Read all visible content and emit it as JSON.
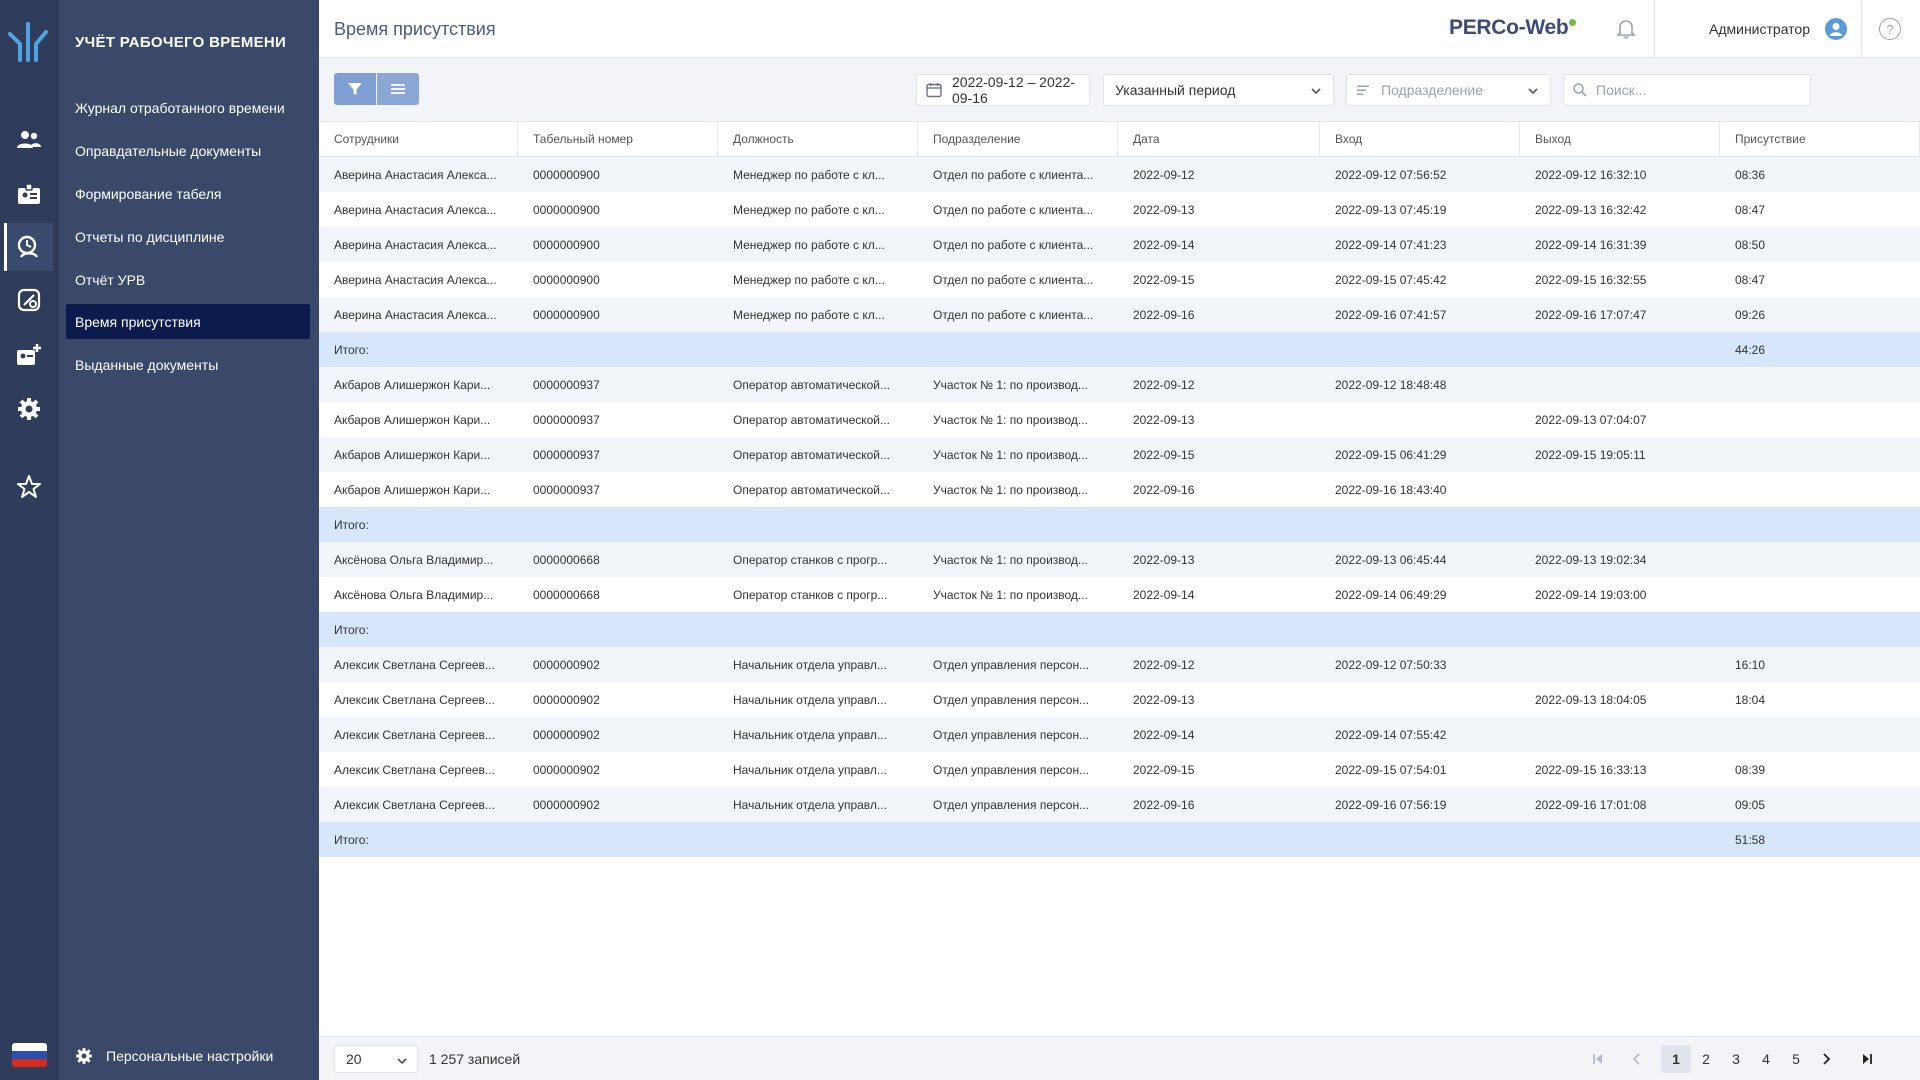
{
  "app": {
    "section_title": "УЧЁТ РАБОЧЕГО ВРЕМЕНИ",
    "page_title": "Время присутствия",
    "brand": "PERCo-Web",
    "user": "Администратор",
    "help_glyph": "?",
    "personal_settings": "Персональные настройки"
  },
  "rail_icons": [
    "logo-icon",
    "users-icon",
    "badge-icon",
    "time-attendance-icon",
    "access-icon",
    "add-employee-icon",
    "settings-icon",
    "favorites-icon",
    "flag-ru-icon"
  ],
  "menu": [
    {
      "label": "Журнал отработанного времени",
      "active": false
    },
    {
      "label": "Оправдательные документы",
      "active": false
    },
    {
      "label": "Формирование табеля",
      "active": false
    },
    {
      "label": "Отчеты по дисциплине",
      "active": false
    },
    {
      "label": "Отчёт УРВ",
      "active": false
    },
    {
      "label": "Время присутствия",
      "active": true
    },
    {
      "label": "Выданные документы",
      "active": false
    }
  ],
  "toolbar": {
    "date_range": "2022-09-12 – 2022-09-16",
    "period": "Указанный период",
    "department_placeholder": "Подразделение",
    "search_placeholder": "Поиск..."
  },
  "table": {
    "columns": [
      "Сотрудники",
      "Табельный номер",
      "Должность",
      "Подразделение",
      "Дата",
      "Вход",
      "Выход",
      "Присутствие"
    ],
    "rows": [
      {
        "type": "data",
        "cells": [
          "Аверина Анастасия Алекса...",
          "0000000900",
          "Менеджер по работе с кл...",
          "Отдел по работе с клиента...",
          "2022-09-12",
          "2022-09-12 07:56:52",
          "2022-09-12 16:32:10",
          "08:36"
        ]
      },
      {
        "type": "data",
        "cells": [
          "Аверина Анастасия Алекса...",
          "0000000900",
          "Менеджер по работе с кл...",
          "Отдел по работе с клиента...",
          "2022-09-13",
          "2022-09-13 07:45:19",
          "2022-09-13 16:32:42",
          "08:47"
        ]
      },
      {
        "type": "data",
        "cells": [
          "Аверина Анастасия Алекса...",
          "0000000900",
          "Менеджер по работе с кл...",
          "Отдел по работе с клиента...",
          "2022-09-14",
          "2022-09-14 07:41:23",
          "2022-09-14 16:31:39",
          "08:50"
        ]
      },
      {
        "type": "data",
        "cells": [
          "Аверина Анастасия Алекса...",
          "0000000900",
          "Менеджер по работе с кл...",
          "Отдел по работе с клиента...",
          "2022-09-15",
          "2022-09-15 07:45:42",
          "2022-09-15 16:32:55",
          "08:47"
        ]
      },
      {
        "type": "data",
        "cells": [
          "Аверина Анастасия Алекса...",
          "0000000900",
          "Менеджер по работе с кл...",
          "Отдел по работе с клиента...",
          "2022-09-16",
          "2022-09-16 07:41:57",
          "2022-09-16 17:07:47",
          "09:26"
        ]
      },
      {
        "type": "total",
        "cells": [
          "Итого:",
          "",
          "",
          "",
          "",
          "",
          "",
          "44:26"
        ]
      },
      {
        "type": "data",
        "cells": [
          "Акбаров Алишержон Кари...",
          "0000000937",
          "Оператор автоматической...",
          "Участок № 1: по производ...",
          "2022-09-12",
          "2022-09-12 18:48:48",
          "",
          ""
        ]
      },
      {
        "type": "data",
        "cells": [
          "Акбаров Алишержон Кари...",
          "0000000937",
          "Оператор автоматической...",
          "Участок № 1: по производ...",
          "2022-09-13",
          "",
          "2022-09-13 07:04:07",
          ""
        ]
      },
      {
        "type": "data",
        "cells": [
          "Акбаров Алишержон Кари...",
          "0000000937",
          "Оператор автоматической...",
          "Участок № 1: по производ...",
          "2022-09-15",
          "2022-09-15 06:41:29",
          "2022-09-15 19:05:11",
          ""
        ]
      },
      {
        "type": "data",
        "cells": [
          "Акбаров Алишержон Кари...",
          "0000000937",
          "Оператор автоматической...",
          "Участок № 1: по производ...",
          "2022-09-16",
          "2022-09-16 18:43:40",
          "",
          ""
        ]
      },
      {
        "type": "total",
        "cells": [
          "Итого:",
          "",
          "",
          "",
          "",
          "",
          "",
          ""
        ]
      },
      {
        "type": "data",
        "cells": [
          "Аксёнова Ольга Владимир...",
          "0000000668",
          "Оператор станков с прогр...",
          "Участок № 1: по производ...",
          "2022-09-13",
          "2022-09-13 06:45:44",
          "2022-09-13 19:02:34",
          ""
        ]
      },
      {
        "type": "data",
        "cells": [
          "Аксёнова Ольга Владимир...",
          "0000000668",
          "Оператор станков с прогр...",
          "Участок № 1: по производ...",
          "2022-09-14",
          "2022-09-14 06:49:29",
          "2022-09-14 19:03:00",
          ""
        ]
      },
      {
        "type": "total",
        "cells": [
          "Итого:",
          "",
          "",
          "",
          "",
          "",
          "",
          ""
        ]
      },
      {
        "type": "data",
        "cells": [
          "Алексик Светлана Сергеев...",
          "0000000902",
          "Начальник отдела управл...",
          "Отдел управления персон...",
          "2022-09-12",
          "2022-09-12 07:50:33",
          "",
          "16:10"
        ]
      },
      {
        "type": "data",
        "cells": [
          "Алексик Светлана Сергеев...",
          "0000000902",
          "Начальник отдела управл...",
          "Отдел управления персон...",
          "2022-09-13",
          "",
          "2022-09-13 18:04:05",
          "18:04"
        ]
      },
      {
        "type": "data",
        "cells": [
          "Алексик Светлана Сергеев...",
          "0000000902",
          "Начальник отдела управл...",
          "Отдел управления персон...",
          "2022-09-14",
          "2022-09-14 07:55:42",
          "",
          ""
        ]
      },
      {
        "type": "data",
        "cells": [
          "Алексик Светлана Сергеев...",
          "0000000902",
          "Начальник отдела управл...",
          "Отдел управления персон...",
          "2022-09-15",
          "2022-09-15 07:54:01",
          "2022-09-15 16:33:13",
          "08:39"
        ]
      },
      {
        "type": "data",
        "cells": [
          "Алексик Светлана Сергеев...",
          "0000000902",
          "Начальник отдела управл...",
          "Отдел управления персон...",
          "2022-09-16",
          "2022-09-16 07:56:19",
          "2022-09-16 17:01:08",
          "09:05"
        ]
      },
      {
        "type": "total",
        "cells": [
          "Итого:",
          "",
          "",
          "",
          "",
          "",
          "",
          "51:58"
        ]
      }
    ]
  },
  "footer": {
    "page_size": "20",
    "records": "1 257 записей",
    "pages": [
      "1",
      "2",
      "3",
      "4",
      "5"
    ],
    "current_page": "1"
  },
  "colors": {
    "rail_bg": "#2f3c5c",
    "menu_bg": "#3a4869",
    "menu_active": "#0d1b4c",
    "total_row": "#d6e6fb",
    "accent": "#7f9fd4"
  }
}
